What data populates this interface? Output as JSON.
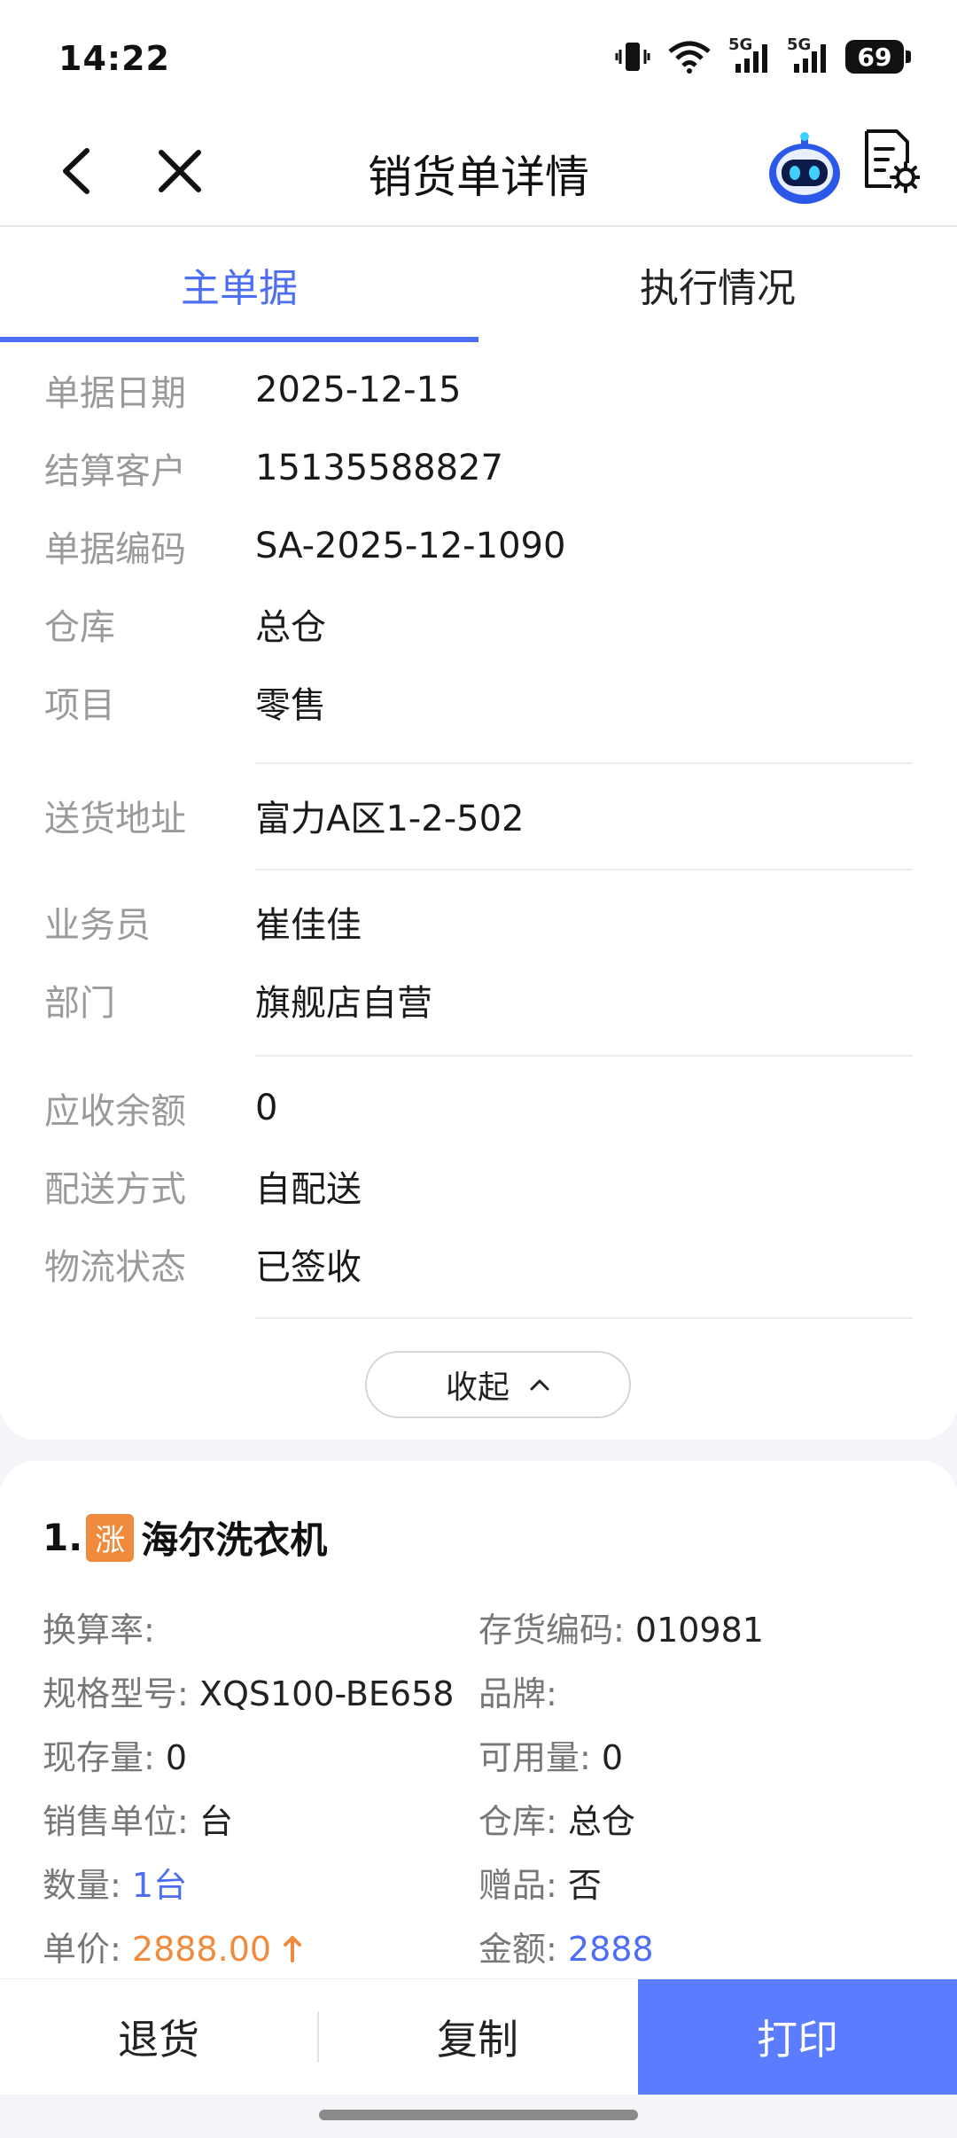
{
  "status_bar": {
    "time": "14:22",
    "battery": "69",
    "network_1": "5G",
    "network_2": "5G"
  },
  "nav": {
    "title": "销货单详情"
  },
  "tabs": [
    {
      "label": "主单据"
    },
    {
      "label": "执行情况"
    }
  ],
  "details": {
    "rows": [
      {
        "label": "单据日期",
        "value": "2025-12-15"
      },
      {
        "label": "结算客户",
        "value": "15135588827"
      },
      {
        "label": "单据编码",
        "value": "SA-2025-12-1090"
      },
      {
        "label": "仓库",
        "value": "总仓"
      },
      {
        "label": "项目",
        "value": "零售"
      },
      {
        "label": "送货地址",
        "value": "富力A区1-2-502"
      },
      {
        "label": "业务员",
        "value": "崔佳佳"
      },
      {
        "label": "部门",
        "value": "旗舰店自营"
      },
      {
        "label": "应收余额",
        "value": "0"
      },
      {
        "label": "配送方式",
        "value": "自配送"
      },
      {
        "label": "物流状态",
        "value": "已签收"
      }
    ],
    "collapse_label": "收起"
  },
  "product": {
    "index": "1.",
    "badge": "涨",
    "name": "海尔洗衣机",
    "fields": {
      "conversion_rate": {
        "label": "换算率:",
        "value": ""
      },
      "stock_code": {
        "label": "存货编码:",
        "value": "010981"
      },
      "spec": {
        "label": "规格型号:",
        "value": "XQS100-BE658"
      },
      "brand": {
        "label": "品牌:",
        "value": ""
      },
      "on_hand": {
        "label": "现存量:",
        "value": "0"
      },
      "available": {
        "label": "可用量:",
        "value": "0"
      },
      "sales_unit": {
        "label": "销售单位:",
        "value": "台"
      },
      "warehouse": {
        "label": "仓库:",
        "value": "总仓"
      },
      "quantity": {
        "label": "数量:",
        "value": "1台"
      },
      "gift": {
        "label": "赠品:",
        "value": "否"
      },
      "unit_price": {
        "label": "单价:",
        "value": "2888.00"
      },
      "amount": {
        "label": "金额:",
        "value": "2888"
      }
    }
  },
  "bottom_bar": {
    "return_label": "退货",
    "copy_label": "复制",
    "print_label": "打印"
  },
  "colors": {
    "accent": "#4e6ef2",
    "primary_button": "#5b7cff",
    "price": "#f08a3c",
    "label_gray": "#9a9a9a"
  }
}
